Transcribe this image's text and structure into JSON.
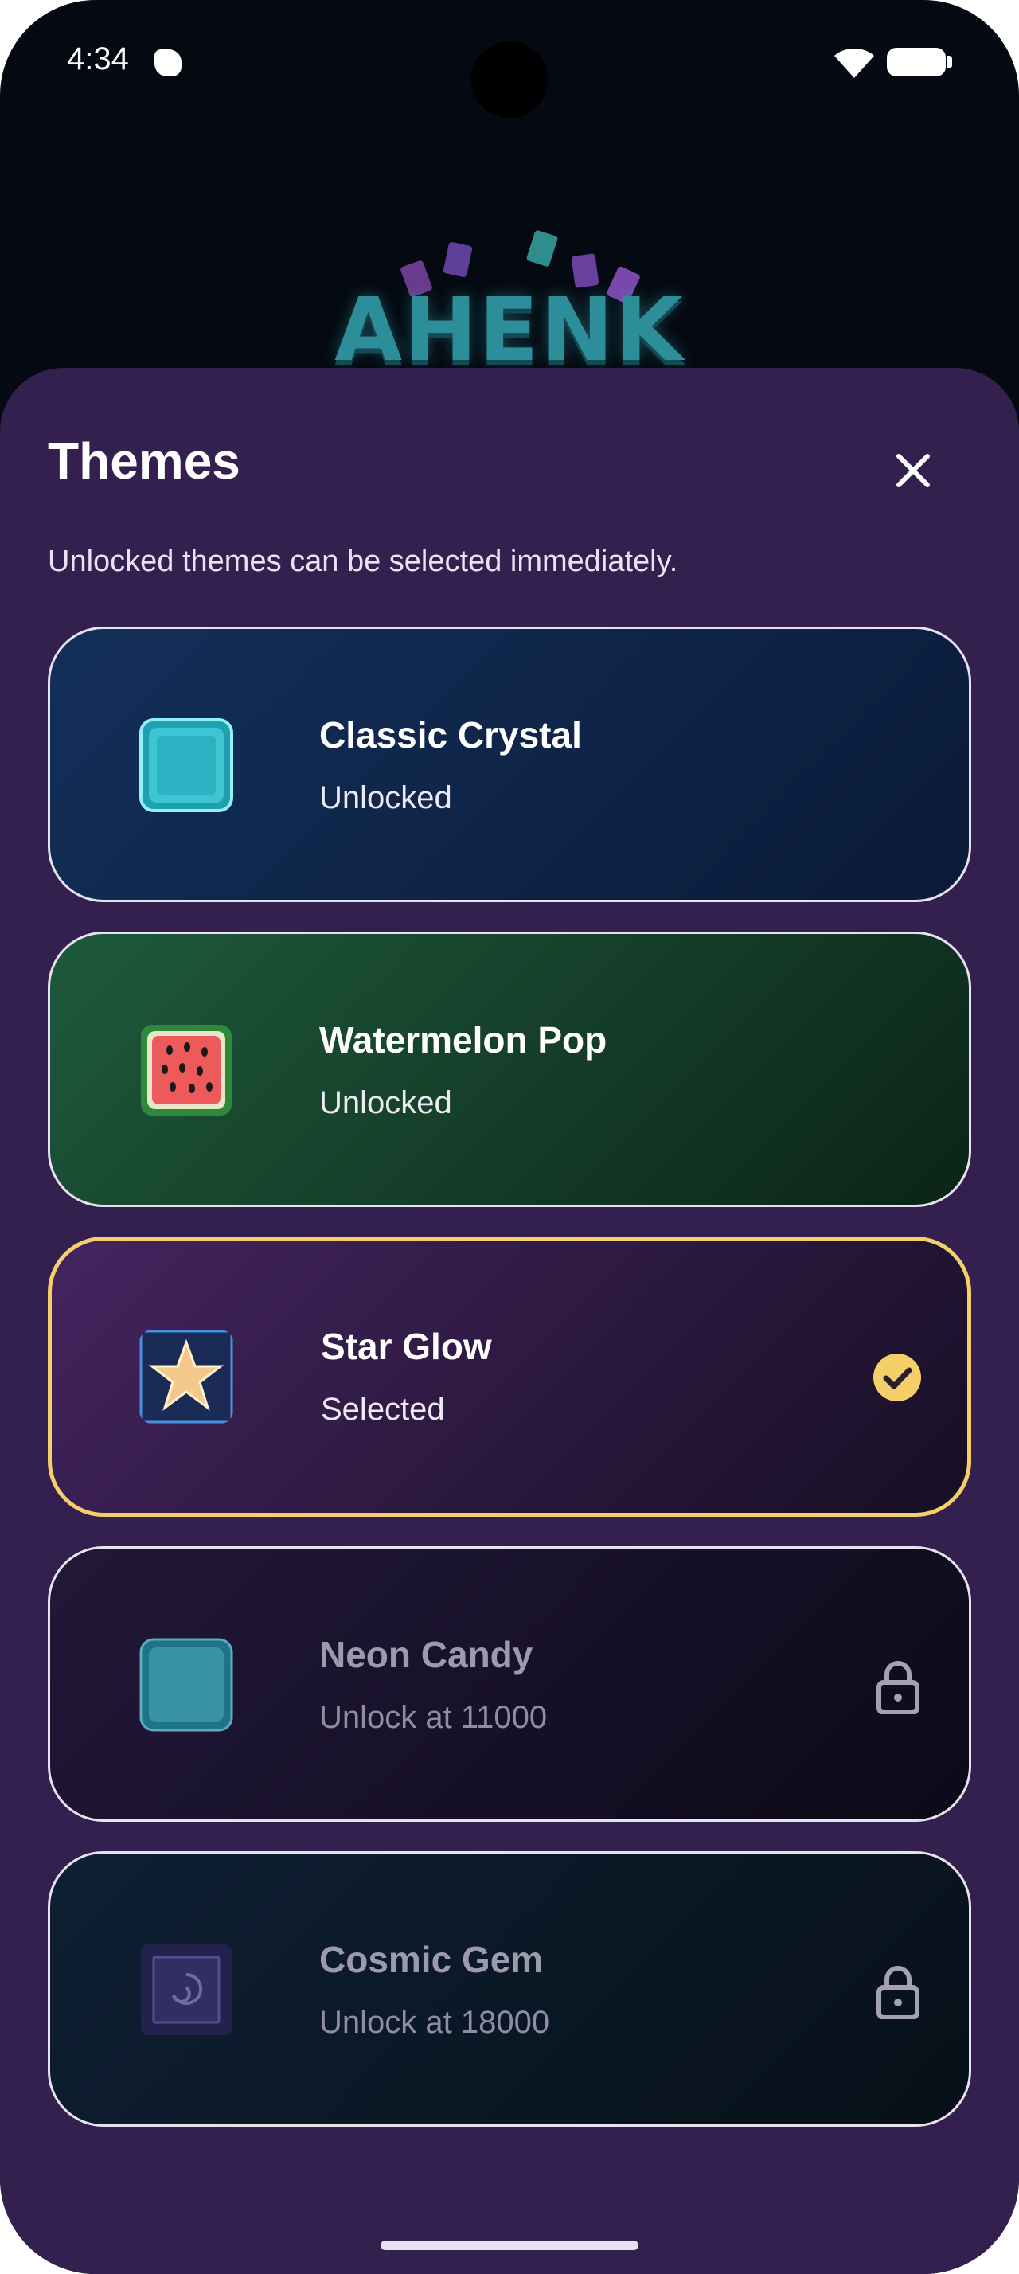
{
  "status_bar": {
    "time": "4:34"
  },
  "logo": {
    "text": "AHENK"
  },
  "sheet": {
    "title": "Themes",
    "subtitle": "Unlocked themes can be selected immediately."
  },
  "themes": [
    {
      "name": "Classic Crystal",
      "status": "Unlocked",
      "state": "unlocked",
      "icon": "crystal-block-icon"
    },
    {
      "name": "Watermelon Pop",
      "status": "Unlocked",
      "state": "unlocked",
      "icon": "watermelon-block-icon"
    },
    {
      "name": "Star Glow",
      "status": "Selected",
      "state": "selected",
      "icon": "star-block-icon"
    },
    {
      "name": "Neon Candy",
      "status": "Unlock at 11000",
      "state": "locked",
      "icon": "neon-block-icon"
    },
    {
      "name": "Cosmic Gem",
      "status": "Unlock at 18000",
      "state": "locked",
      "icon": "cosmic-block-icon"
    }
  ],
  "colors": {
    "sheet_background": "#33204f",
    "selected_border": "#f5cf6a",
    "card_border": "#e6e2ee",
    "check_fill": "#f5cf6a"
  }
}
